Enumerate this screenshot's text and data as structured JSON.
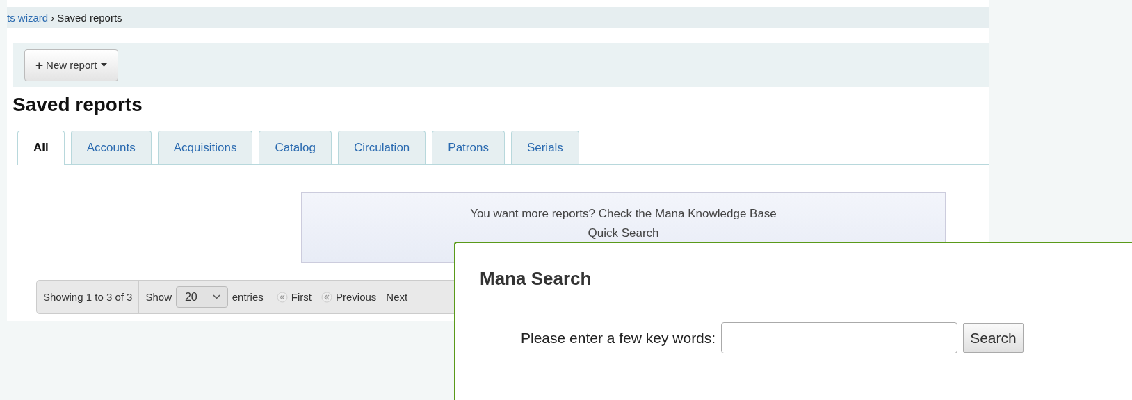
{
  "breadcrumb": {
    "link": "ts wizard",
    "separator": "›",
    "current": "Saved reports"
  },
  "toolbar": {
    "new_button": {
      "icon": "+",
      "label": "New report"
    }
  },
  "heading": "Saved reports",
  "tabs": [
    {
      "label": "All",
      "selected": true
    },
    {
      "label": "Accounts",
      "selected": false
    },
    {
      "label": "Acquisitions",
      "selected": false
    },
    {
      "label": "Catalog",
      "selected": false
    },
    {
      "label": "Circulation",
      "selected": false
    },
    {
      "label": "Patrons",
      "selected": false
    },
    {
      "label": "Serials",
      "selected": false
    }
  ],
  "mana_notice": {
    "text": "You want more reports? Check the Mana Knowledge Base",
    "link": "Quick Search"
  },
  "pager": {
    "info": "Showing 1 to 3 of 3",
    "show_label": "Show",
    "page_size": "20",
    "entries_label": "entries",
    "first": "First",
    "previous": "Previous",
    "next": "Next"
  },
  "modal": {
    "title": "Mana Search",
    "prompt": "Please enter a few key words:",
    "button": "Search"
  }
}
